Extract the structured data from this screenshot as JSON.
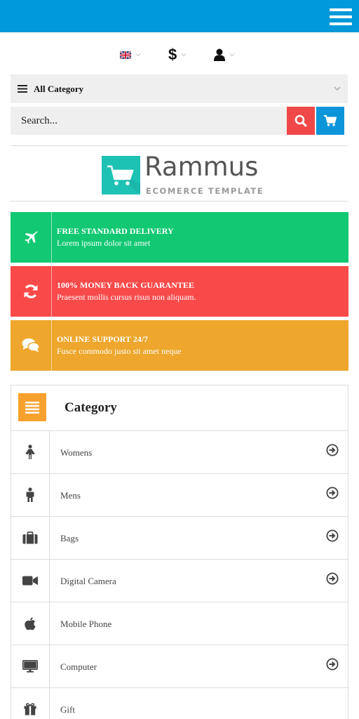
{
  "header": {
    "menu_icon": "hamburger-menu-icon",
    "bg_color": "#0099d9"
  },
  "toolbar": {
    "language_icon": "uk-flag-icon",
    "currency_symbol": "$",
    "account_icon": "user-icon"
  },
  "category_select": {
    "label": "All Category"
  },
  "search": {
    "placeholder": "Search...",
    "search_icon": "search-icon",
    "cart_icon": "cart-icon"
  },
  "logo": {
    "name": "Rammus",
    "tagline": "ECOMERCE TEMPLATE",
    "color": "#1ec2b4"
  },
  "features": [
    {
      "title": "FREE STANDARD DELIVERY",
      "desc": "Lorem ipsum dolor sit amet",
      "icon": "airplane-icon",
      "color": "#12c872"
    },
    {
      "title": "100% MONEY BACK GUARANTEE",
      "desc": "Praesent mollis cursus risus non aliquam.",
      "icon": "refresh-icon",
      "color": "#f94a4a"
    },
    {
      "title": "ONLINE SUPPORT 24/7",
      "desc": "Fusce commodo justo sit amet neque",
      "icon": "chat-bubbles-icon",
      "color": "#eea62c"
    }
  ],
  "category_panel": {
    "title": "Category",
    "icon": "list-icon",
    "accent": "#f9a12e",
    "items": [
      {
        "label": "Womens",
        "icon": "female-icon",
        "has_arrow": true
      },
      {
        "label": "Mens",
        "icon": "male-icon",
        "has_arrow": true
      },
      {
        "label": "Bags",
        "icon": "briefcase-icon",
        "has_arrow": true
      },
      {
        "label": "Digital Camera",
        "icon": "video-camera-icon",
        "has_arrow": true
      },
      {
        "label": "Mobile Phone",
        "icon": "apple-icon",
        "has_arrow": false
      },
      {
        "label": "Computer",
        "icon": "desktop-icon",
        "has_arrow": true
      },
      {
        "label": "Gift",
        "icon": "gift-icon",
        "has_arrow": false
      }
    ]
  }
}
